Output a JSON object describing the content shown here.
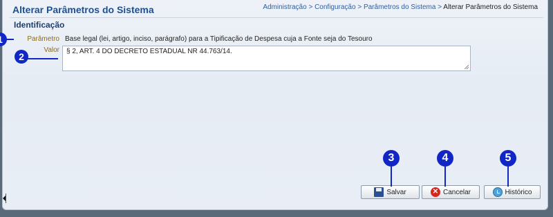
{
  "header": {
    "title": "Alterar Parâmetros do Sistema",
    "breadcrumb": {
      "path": "Administração > Configuração > Parâmetros do Sistema > ",
      "current": "Alterar Parâmetros do Sistema"
    }
  },
  "section": {
    "title": "Identificação"
  },
  "form": {
    "parametro_label": "Parâmetro",
    "parametro_value": "Base legal (lei, artigo, inciso, parágrafo) para a Tipificação de Despesa cuja a Fonte seja do Tesouro",
    "valor_label": "Valor",
    "valor_value": "§ 2, ART. 4 DO DECRETO ESTADUAL NR 44.763/14."
  },
  "buttons": {
    "salvar": "Salvar",
    "cancelar": "Cancelar",
    "historico": "Histórico"
  },
  "annotations": [
    "1",
    "2",
    "3",
    "4",
    "5"
  ],
  "colors": {
    "annotation": "#1126c7",
    "title": "#1f4f8f",
    "label": "#8a6a1e"
  }
}
